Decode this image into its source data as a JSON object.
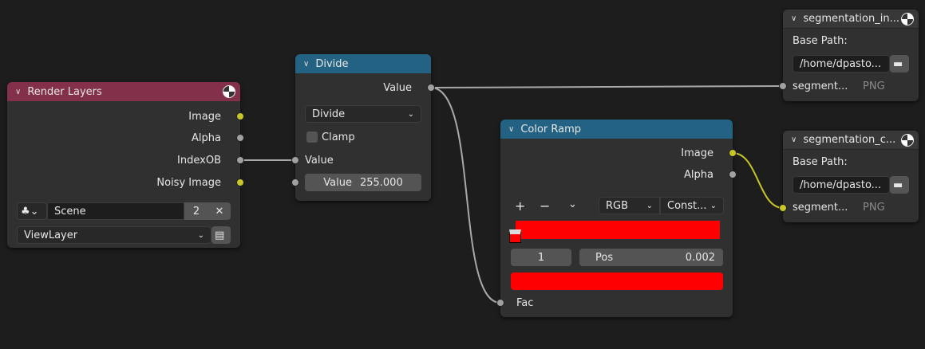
{
  "render_layers": {
    "title": "Render Layers",
    "outputs": [
      "Image",
      "Alpha",
      "IndexOB",
      "Noisy Image"
    ],
    "scene": "Scene",
    "scene_users": "2",
    "view_layer": "ViewLayer",
    "header_color": "#83314a"
  },
  "divide": {
    "title": "Divide",
    "output": "Value",
    "operation": "Divide",
    "clamp_label": "Clamp",
    "input_label": "Value",
    "value_label": "Value",
    "value": "255.000",
    "header_color": "#246283"
  },
  "color_ramp": {
    "title": "Color Ramp",
    "outputs": [
      "Image",
      "Alpha"
    ],
    "add": "+",
    "remove": "−",
    "menu": "⌄",
    "color_mode": "RGB",
    "interpolation": "Const...",
    "stop_index": "1",
    "pos_label": "Pos",
    "pos_value": "0.002",
    "fac_label": "Fac",
    "ramp_color": "#ff0000"
  },
  "outputs": [
    {
      "title": "segmentation_in...",
      "base_path_label": "Base Path:",
      "path": "/home/dpasto...",
      "input": "segment...",
      "format": "PNG"
    },
    {
      "title": "segmentation_c...",
      "base_path_label": "Base Path:",
      "path": "/home/dpasto...",
      "input": "segment...",
      "format": "PNG"
    }
  ]
}
